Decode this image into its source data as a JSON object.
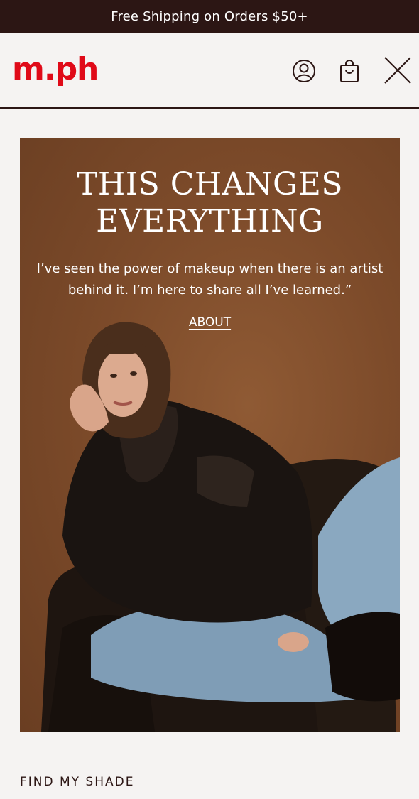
{
  "announcement": {
    "text": "Free Shipping on Orders $50+"
  },
  "header": {
    "logo": "m.ph",
    "icons": [
      "account-icon",
      "shopping-bag-icon",
      "close-icon"
    ]
  },
  "hero": {
    "title_line1": "THIS CHANGES",
    "title_line2": "EVERYTHING",
    "quote": "I’ve seen the power of makeup when there is an artist behind it. I’m here to share all I’ve learned.”",
    "link_label": "ABOUT"
  },
  "menu": {
    "find_my_shade": "FIND MY SHADE"
  },
  "colors": {
    "announcement_bg": "#2c1614",
    "brand_red": "#e00a18",
    "hero_bg": "#7d4b2a",
    "page_bg": "#f5f3f2"
  }
}
